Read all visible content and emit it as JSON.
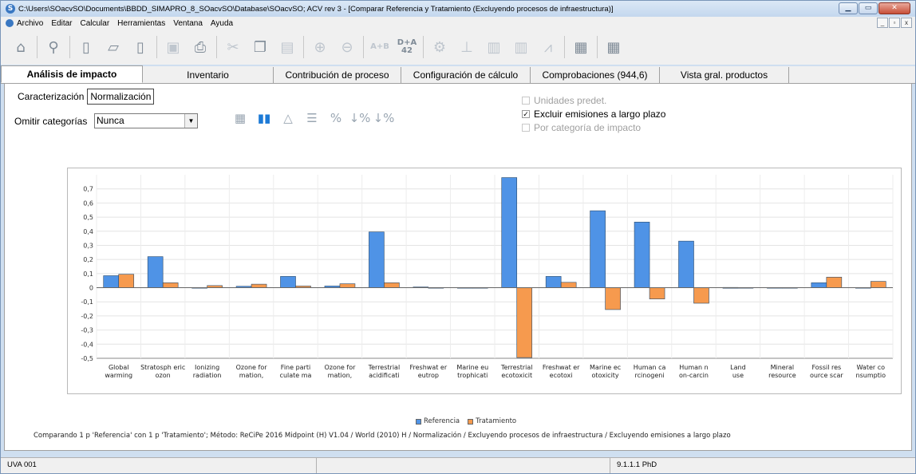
{
  "window": {
    "title": "C:\\Users\\SOacvSO\\Documents\\BBDD_SIMAPRO_8_SOacvSO\\Database\\SOacvSO; ACV rev 3 - [Comparar Referencia y Tratamiento (Excluyendo procesos de infraestructura)]",
    "controls": [
      "▁",
      "▭",
      "✕"
    ]
  },
  "menu": {
    "items": [
      "Archivo",
      "Editar",
      "Calcular",
      "Herramientas",
      "Ventana",
      "Ayuda"
    ],
    "mdi_controls": [
      "_",
      "▫",
      "x"
    ]
  },
  "toolbar": {
    "buttons": [
      {
        "icon": "home-icon",
        "glyph": "⌂"
      },
      {
        "icon": "search-icon",
        "glyph": "⚲"
      },
      {
        "icon": "new-document-icon",
        "glyph": "▯"
      },
      {
        "icon": "open-folder-icon",
        "glyph": "▱"
      },
      {
        "icon": "close-document-icon",
        "glyph": "▯"
      },
      {
        "icon": "save-icon",
        "glyph": "▣"
      },
      {
        "icon": "print-icon",
        "glyph": "⎙"
      },
      {
        "icon": "cut-icon",
        "glyph": "✂"
      },
      {
        "icon": "copy-icon",
        "glyph": "❐"
      },
      {
        "icon": "paste-icon",
        "glyph": "▤"
      },
      {
        "icon": "insert-line-icon",
        "glyph": "⊕"
      },
      {
        "icon": "delete-line-icon",
        "glyph": "⊖"
      },
      {
        "icon": "a-plus-b-icon",
        "text": "A+B"
      },
      {
        "icon": "d-plus-a-icon",
        "text": "D+A 42"
      },
      {
        "icon": "network-icon",
        "glyph": "⚙"
      },
      {
        "icon": "tree-icon",
        "glyph": "⊥"
      },
      {
        "icon": "single-chart-icon",
        "glyph": "▥"
      },
      {
        "icon": "compare-chart-icon",
        "glyph": "▥"
      },
      {
        "icon": "curve-icon",
        "glyph": "⩘"
      },
      {
        "icon": "report-icon",
        "glyph": "▦"
      },
      {
        "icon": "calculator-icon",
        "glyph": "▦"
      }
    ]
  },
  "tabs": [
    {
      "label": "Análisis de impacto",
      "active": true
    },
    {
      "label": "Inventario",
      "active": false
    },
    {
      "label": "Contribución de proceso",
      "active": false
    },
    {
      "label": "Configuración de cálculo",
      "active": false
    },
    {
      "label": "Comprobaciones (944,6)",
      "active": false
    },
    {
      "label": "Vista gral. productos",
      "active": false
    }
  ],
  "subtabs": [
    {
      "label": "Caracterización",
      "active": false
    },
    {
      "label": "Normalización",
      "active": true
    }
  ],
  "omit": {
    "label": "Omitir categorías",
    "value": "Nunca"
  },
  "view_icons": [
    {
      "icon": "table-view-icon",
      "glyph": "▦",
      "active": false
    },
    {
      "icon": "bar-chart-view-icon",
      "glyph": "▮▮",
      "active": true
    },
    {
      "icon": "triangle-view-icon",
      "glyph": "△",
      "active": false
    },
    {
      "icon": "settings-sliders-icon",
      "glyph": "☰",
      "active": false
    },
    {
      "icon": "percent-icon",
      "glyph": "%",
      "active": false
    },
    {
      "icon": "percent-down-icon",
      "glyph": "↓%",
      "active": false
    },
    {
      "icon": "percent-fraction-icon",
      "glyph": "↓%",
      "active": false
    }
  ],
  "options": [
    {
      "label": "Unidades predet.",
      "checked": false,
      "enabled": false
    },
    {
      "label": "Excluir emisiones a largo plazo",
      "checked": true,
      "enabled": true
    },
    {
      "label": "Por categoría de impacto",
      "checked": false,
      "enabled": false
    }
  ],
  "colors": {
    "referencia": "#4f93e6",
    "tratamiento": "#f69a4e"
  },
  "chart_data": {
    "type": "bar",
    "categories": [
      "Global warming",
      "Stratosph eric ozon",
      "Ionizing radiation",
      "Ozone for mation,",
      "Fine parti culate ma",
      "Ozone for mation,",
      "Terrestrial acidificati",
      "Freshwat er eutrop",
      "Marine eu trophicati",
      "Terrestrial ecotoxicit",
      "Freshwat er ecotoxi",
      "Marine ec otoxicity",
      "Human ca rcinogeni",
      "Human n on-carcin",
      "Land use",
      "Mineral resource",
      "Fossil res ource scar",
      "Water co nsumptio"
    ],
    "series": [
      {
        "name": "Referencia",
        "values": [
          0.085,
          0.22,
          0.0,
          0.01,
          0.08,
          0.012,
          0.395,
          0.005,
          0.0,
          0.78,
          0.08,
          0.545,
          0.465,
          0.33,
          0.002,
          0.0,
          0.035,
          0.0
        ]
      },
      {
        "name": "Tratamiento",
        "values": [
          0.095,
          0.035,
          0.015,
          0.025,
          0.012,
          0.028,
          0.035,
          0.0,
          0.0,
          -0.495,
          0.038,
          -0.155,
          -0.08,
          -0.11,
          0.0,
          0.0,
          0.075,
          0.045
        ]
      }
    ],
    "yticks": [
      "0,7",
      "0,6",
      "0,5",
      "0,4",
      "0,3",
      "0,2",
      "0,1",
      "0",
      "-0,1",
      "-0,2",
      "-0,3",
      "-0,4",
      "-0,5"
    ],
    "ylim": [
      -0.5,
      0.8
    ],
    "grid": true,
    "legend": "bottom"
  },
  "caption": "Comparando 1 p 'Referencia' con 1 p 'Tratamiento'; Método: ReCiPe 2016 Midpoint (H) V1.04 / World (2010) H / Normalización / Excluyendo procesos de infraestructura / Excluyendo emisiones a largo plazo",
  "status": {
    "left": "UVA 001",
    "middle": "",
    "right": "9.1.1.1 PhD"
  }
}
